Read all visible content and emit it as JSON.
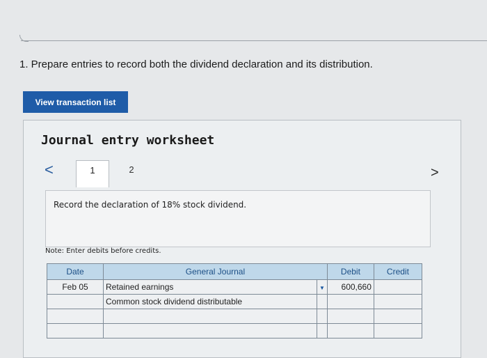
{
  "question": "1. Prepare entries to record both the dividend declaration and its distribution.",
  "view_transaction_button": "View transaction list",
  "worksheet": {
    "title": "Journal entry worksheet",
    "nav_prev": "<",
    "nav_next": ">",
    "tabs": [
      "1",
      "2"
    ],
    "active_tab": "1",
    "instruction": "Record the declaration of 18% stock dividend.",
    "note": "Note: Enter debits before credits."
  },
  "table": {
    "headers": {
      "date": "Date",
      "account": "General Journal",
      "debit": "Debit",
      "credit": "Credit"
    },
    "rows": [
      {
        "date": "Feb 05",
        "account": "Retained earnings",
        "debit": "600,660",
        "credit": ""
      },
      {
        "date": "",
        "account": "Common stock dividend distributable",
        "debit": "",
        "credit": ""
      },
      {
        "date": "",
        "account": "",
        "debit": "",
        "credit": ""
      },
      {
        "date": "",
        "account": "",
        "debit": "",
        "credit": ""
      }
    ]
  },
  "colors": {
    "button_bg": "#1f5ca8",
    "header_bg": "#bfd8ea",
    "header_text": "#1c4f86",
    "input_border": "#1a57a0"
  }
}
